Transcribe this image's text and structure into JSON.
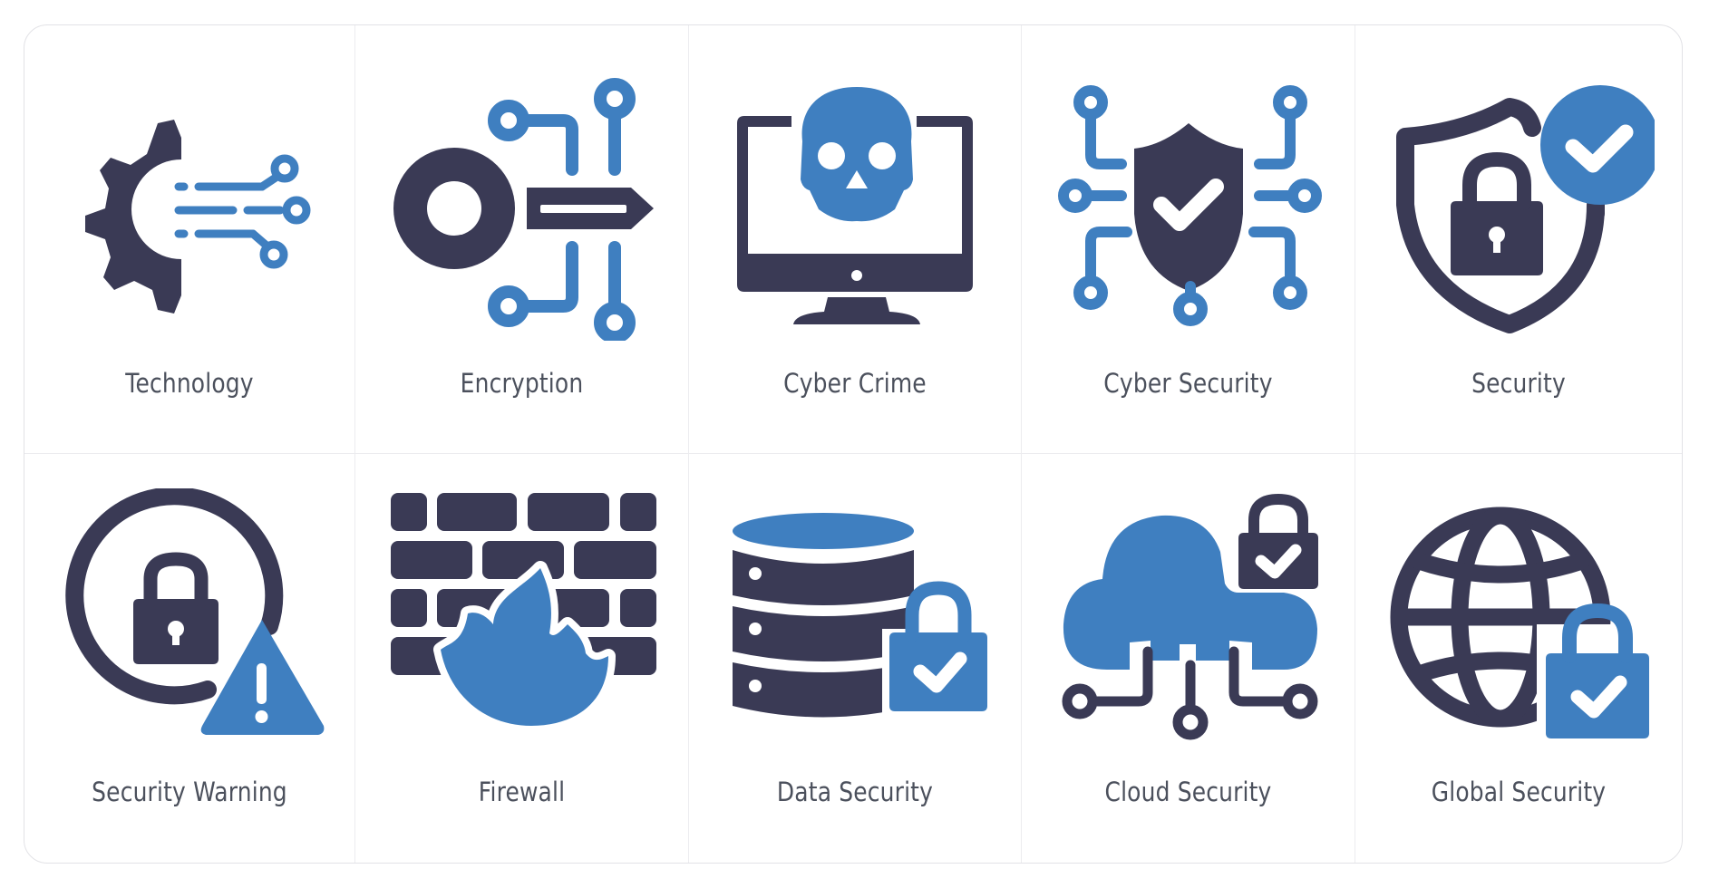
{
  "colors": {
    "primary_dark": "#3a3a55",
    "accent_blue": "#3f7fc0",
    "label_text": "#4b505c",
    "divider": "#ececef",
    "background": "#ffffff"
  },
  "icon_set": {
    "items": [
      {
        "label": "Technology",
        "icon": "gear-circuit-icon"
      },
      {
        "label": "Encryption",
        "icon": "key-circuit-icon"
      },
      {
        "label": "Cyber Crime",
        "icon": "skull-monitor-icon"
      },
      {
        "label": "Cyber Security",
        "icon": "shield-check-circuit-icon"
      },
      {
        "label": "Security",
        "icon": "shield-lock-check-icon"
      },
      {
        "label": "Security Warning",
        "icon": "lock-warning-icon"
      },
      {
        "label": "Firewall",
        "icon": "brick-wall-fire-icon"
      },
      {
        "label": "Data Security",
        "icon": "database-lock-icon"
      },
      {
        "label": "Cloud Security",
        "icon": "cloud-lock-circuit-icon"
      },
      {
        "label": "Global Security",
        "icon": "globe-lock-icon"
      }
    ]
  }
}
